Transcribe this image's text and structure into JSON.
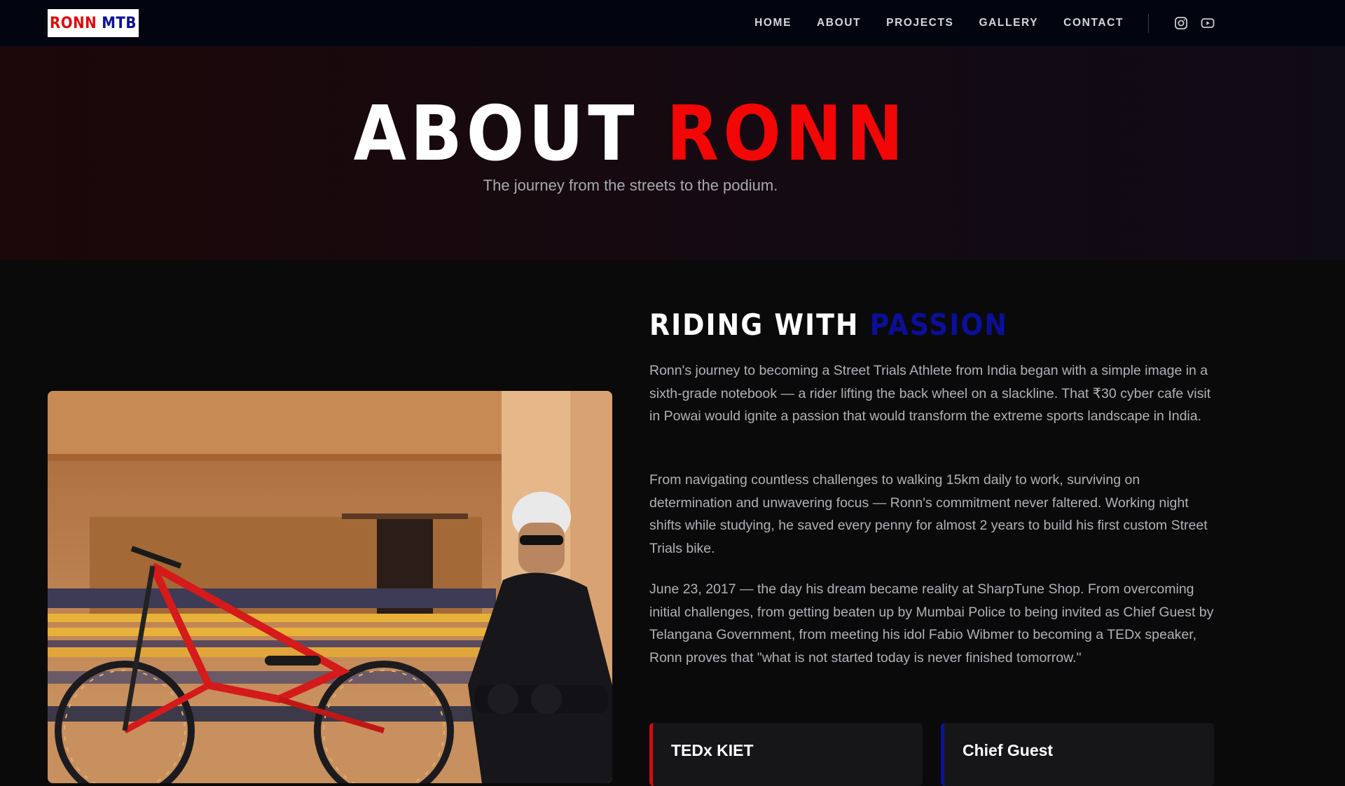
{
  "brand": {
    "logo_part1": "RONN",
    "logo_part2": "MTB"
  },
  "nav": {
    "items": [
      {
        "label": "HOME"
      },
      {
        "label": "ABOUT"
      },
      {
        "label": "PROJECTS"
      },
      {
        "label": "GALLERY"
      },
      {
        "label": "CONTACT"
      }
    ],
    "social": [
      "instagram-icon",
      "youtube-icon"
    ]
  },
  "hero": {
    "title_part1": "ABOUT",
    "title_part2": "RONN",
    "subtitle": "The journey from the streets to the podium."
  },
  "about": {
    "heading_part1": "RIDING WITH",
    "heading_part2": "PASSION",
    "paragraphs": [
      "Ronn's journey to becoming a Street Trials Athlete from India began with a simple image in a sixth-grade notebook — a rider lifting the back wheel on a slackline. That ₹30 cyber cafe visit in Powai would ignite a passion that would transform the extreme sports landscape in India.",
      "From navigating countless challenges to walking 15km daily to work, surviving on determination and unwavering focus — Ronn's commitment never faltered. Working night shifts while studying, he saved every penny for almost 2 years to build his first custom Street Trials bike.",
      "June 23, 2017 — the day his dream became reality at SharpTune Shop. From overcoming initial challenges, from getting beaten up by Mumbai Police to being invited as Chief Guest by Telangana Government, from meeting his idol Fabio Wibmer to becoming a TEDx speaker, Ronn proves that \"what is not started today is never finished tomorrow.\""
    ],
    "cards": [
      {
        "title": "TEDx KIET"
      },
      {
        "title": "Chief Guest"
      }
    ]
  },
  "colors": {
    "accent_red": "#f20606",
    "accent_blue": "#0b0f9a",
    "nav_bg": "#02050f",
    "page_bg": "#0a0a0b"
  }
}
